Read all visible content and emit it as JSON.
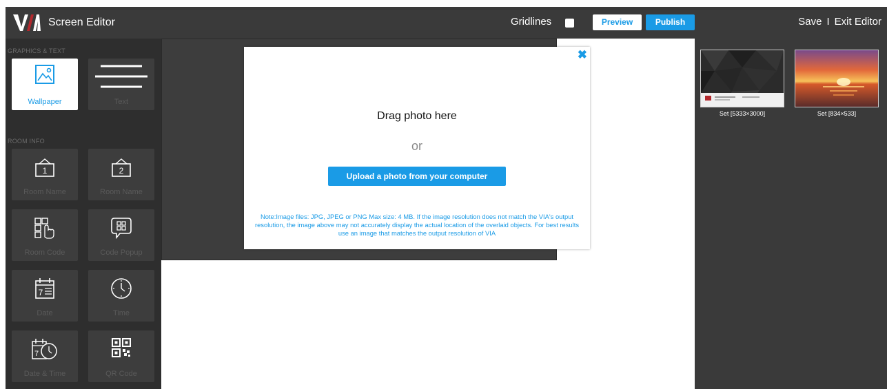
{
  "header": {
    "logo_text": "VIA",
    "title": "Screen Editor",
    "gridlines_label": "Gridlines",
    "gridlines_checked": false,
    "preview_label": "Preview",
    "publish_label": "Publish",
    "save_label": "Save",
    "separator": "I",
    "exit_label": "Exit Editor"
  },
  "sidebar": {
    "graphics_section": "GRAPHICS & TEXT",
    "room_section": "ROOM INFO",
    "tiles": [
      {
        "label": "Wallpaper",
        "icon": "wallpaper-icon",
        "active": true
      },
      {
        "label": "Text",
        "icon": "text-lines-icon",
        "active": false
      },
      {
        "label": "Room Name",
        "icon": "room-name-1-icon",
        "active": false
      },
      {
        "label": "Room Name",
        "icon": "room-name-2-icon",
        "active": false
      },
      {
        "label": "Room Code",
        "icon": "room-code-icon",
        "active": false
      },
      {
        "label": "Code Popup",
        "icon": "code-popup-icon",
        "active": false
      },
      {
        "label": "Date",
        "icon": "calendar-icon",
        "active": false
      },
      {
        "label": "Time",
        "icon": "clock-icon",
        "active": false
      },
      {
        "label": "Date & Time",
        "icon": "date-time-icon",
        "active": false
      },
      {
        "label": "QR Code",
        "icon": "qr-code-icon",
        "active": false
      }
    ]
  },
  "modal": {
    "drag_text": "Drag photo here",
    "or_text": "or",
    "upload_label": "Upload a photo from your computer",
    "note": "Note:Image files: JPG, JPEG or PNG Max size: 4 MB. If the image resolution does not match the VIA's output resolution, the image above may not accurately display the actual location of the overlaid objects. For best results use an image that matches the output resolution of VIA"
  },
  "wallpapers": [
    {
      "label": "Set [5333×3000]",
      "thumb": "dark-polygon-wallpaper"
    },
    {
      "label": "Set [834×533]",
      "thumb": "sunset-sea-wallpaper"
    }
  ],
  "colors": {
    "accent": "#1a9be6",
    "header_bg": "#3a3a3a",
    "sidebar_bg": "#2e2e2e",
    "tile_bg": "#3d3d3d",
    "logo_accent": "#b3282d"
  }
}
